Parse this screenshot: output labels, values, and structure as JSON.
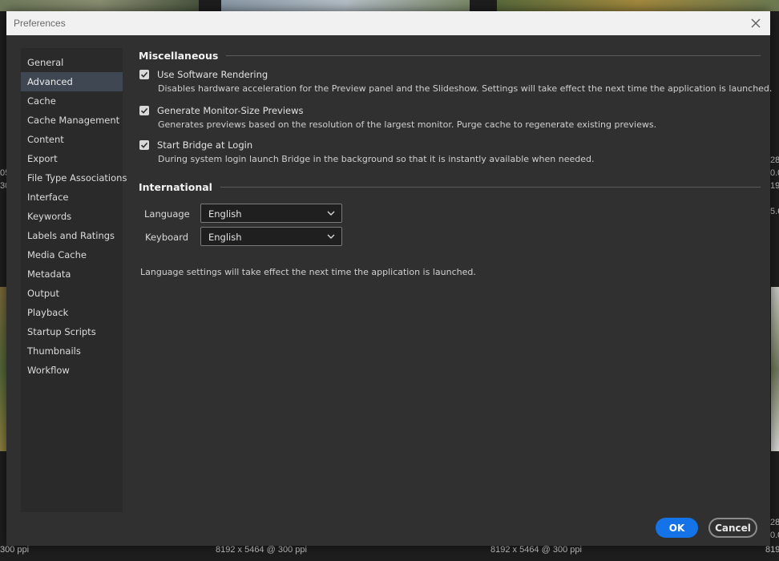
{
  "background": {
    "captions": [
      "8192 x 5464 @ 300 ppi",
      "8192 x 5464 @ 300 ppi"
    ],
    "left_edge": [
      "05",
      "30",
      "300 ppi"
    ],
    "right_edge": [
      "28",
      "0.0",
      "19",
      "5.6",
      "28",
      "0.0",
      "819"
    ]
  },
  "dialog": {
    "title": "Preferences",
    "close_icon": "close-icon"
  },
  "sidebar": {
    "items": [
      {
        "label": "General"
      },
      {
        "label": "Advanced",
        "selected": true
      },
      {
        "label": "Cache"
      },
      {
        "label": "Cache Management"
      },
      {
        "label": "Content"
      },
      {
        "label": "Export"
      },
      {
        "label": "File Type Associations"
      },
      {
        "label": "Interface"
      },
      {
        "label": "Keywords"
      },
      {
        "label": "Labels and Ratings"
      },
      {
        "label": "Media Cache"
      },
      {
        "label": "Metadata"
      },
      {
        "label": "Output"
      },
      {
        "label": "Playback"
      },
      {
        "label": "Startup Scripts"
      },
      {
        "label": "Thumbnails"
      },
      {
        "label": "Workflow"
      }
    ]
  },
  "miscellaneous": {
    "heading": "Miscellaneous",
    "options": [
      {
        "label": "Use Software Rendering",
        "checked": true,
        "description": "Disables hardware acceleration for the Preview panel and the Slideshow. Settings will take effect the next time the application is launched."
      },
      {
        "label": "Generate Monitor-Size Previews",
        "checked": true,
        "description": "Generates previews based on the resolution of the largest monitor.  Purge cache to regenerate existing previews."
      },
      {
        "label": "Start Bridge at Login",
        "checked": true,
        "description": "During system login launch Bridge in the background so that it is instantly available when needed."
      }
    ]
  },
  "international": {
    "heading": "International",
    "language_label": "Language",
    "language_value": "English",
    "keyboard_label": "Keyboard",
    "keyboard_value": "English",
    "note": "Language settings will take effect the next time the application is launched."
  },
  "buttons": {
    "ok": "OK",
    "cancel": "Cancel"
  },
  "colors": {
    "accent": "#1473e6",
    "dialog_bg": "#303030",
    "selected_item": "#3e4752"
  }
}
